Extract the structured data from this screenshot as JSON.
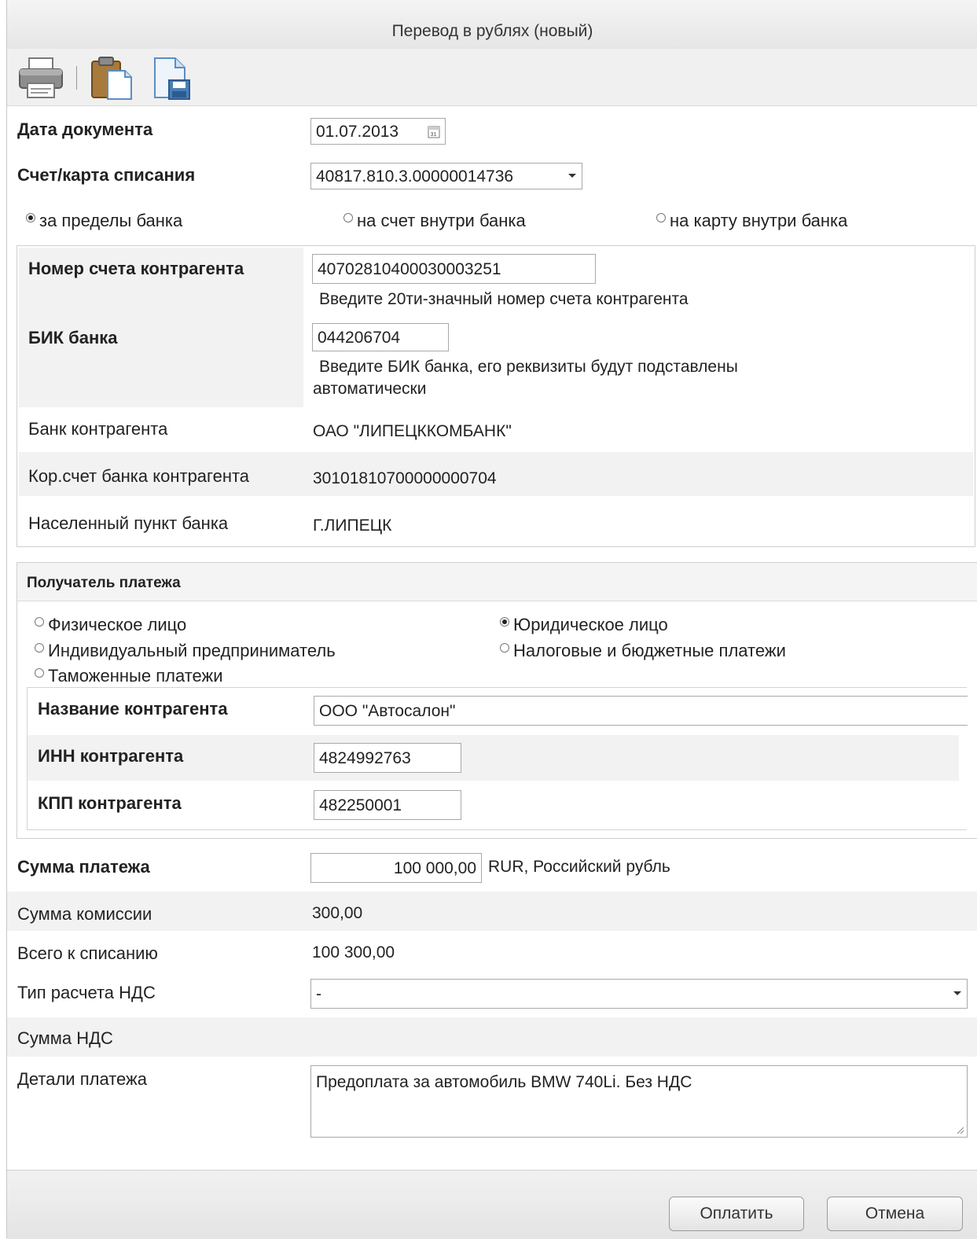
{
  "window": {
    "title": "Перевод в рублях (новый)"
  },
  "toolbar": {
    "print_icon": "printer-icon",
    "paste_icon": "clipboard-icon",
    "save_icon": "save-document-icon"
  },
  "form": {
    "doc_date_label": "Дата документа",
    "doc_date_value": "01.07.2013",
    "account_label": "Счет/карта списания",
    "account_value": "40817.810.3.00000014736",
    "transfer_types": [
      {
        "label": "за пределы банка",
        "selected": true
      },
      {
        "label": "на счет внутри банка",
        "selected": false
      },
      {
        "label": "на карту внутри банка",
        "selected": false
      }
    ]
  },
  "bank": {
    "acct_label": "Номер счета контрагента",
    "acct_value": "40702810400030003251",
    "acct_hint": "Введите 20ти-значный номер счета контрагента",
    "bik_label": "БИК банка",
    "bik_value": "044206704",
    "bik_hint_1": "Введите БИК банка, его реквизиты будут подставлены",
    "bik_hint_2": "автоматически",
    "bank_name_label": "Банк контрагента",
    "bank_name_value": "ОАО \"ЛИПЕЦККОМБАНК\"",
    "corr_label": "Кор.счет банка контрагента",
    "corr_value": "30101810700000000704",
    "city_label": "Населенный пункт банка",
    "city_value": "Г.ЛИПЕЦК"
  },
  "recipient": {
    "section_title": "Получатель платежа",
    "types": [
      {
        "label": "Физическое лицо",
        "selected": false
      },
      {
        "label": "Юридическое лицо",
        "selected": true
      },
      {
        "label": "Индивидуальный предприниматель",
        "selected": false
      },
      {
        "label": "Налоговые и бюджетные платежи",
        "selected": false
      },
      {
        "label": "Таможенные платежи",
        "selected": false
      }
    ],
    "name_label": "Название контрагента",
    "name_value": "ООО \"Автосалон\"",
    "inn_label": "ИНН контрагента",
    "inn_value": "4824992763",
    "kpp_label": "КПП контрагента",
    "kpp_value": "482250001"
  },
  "payment": {
    "amount_label": "Сумма платежа",
    "amount_value": "100 000,00",
    "currency": "RUR, Российский рубль",
    "fee_label": "Сумма комиссии",
    "fee_value": "300,00",
    "total_label": "Всего к списанию",
    "total_value": "100 300,00",
    "vat_type_label": "Тип расчета НДС",
    "vat_type_value": "-",
    "vat_sum_label": "Сумма НДС",
    "details_label": "Детали платежа",
    "details_value": "Предоплата за автомобиль BMW 740Li. Без НДС"
  },
  "buttons": {
    "pay": "Оплатить",
    "cancel": "Отмена"
  }
}
